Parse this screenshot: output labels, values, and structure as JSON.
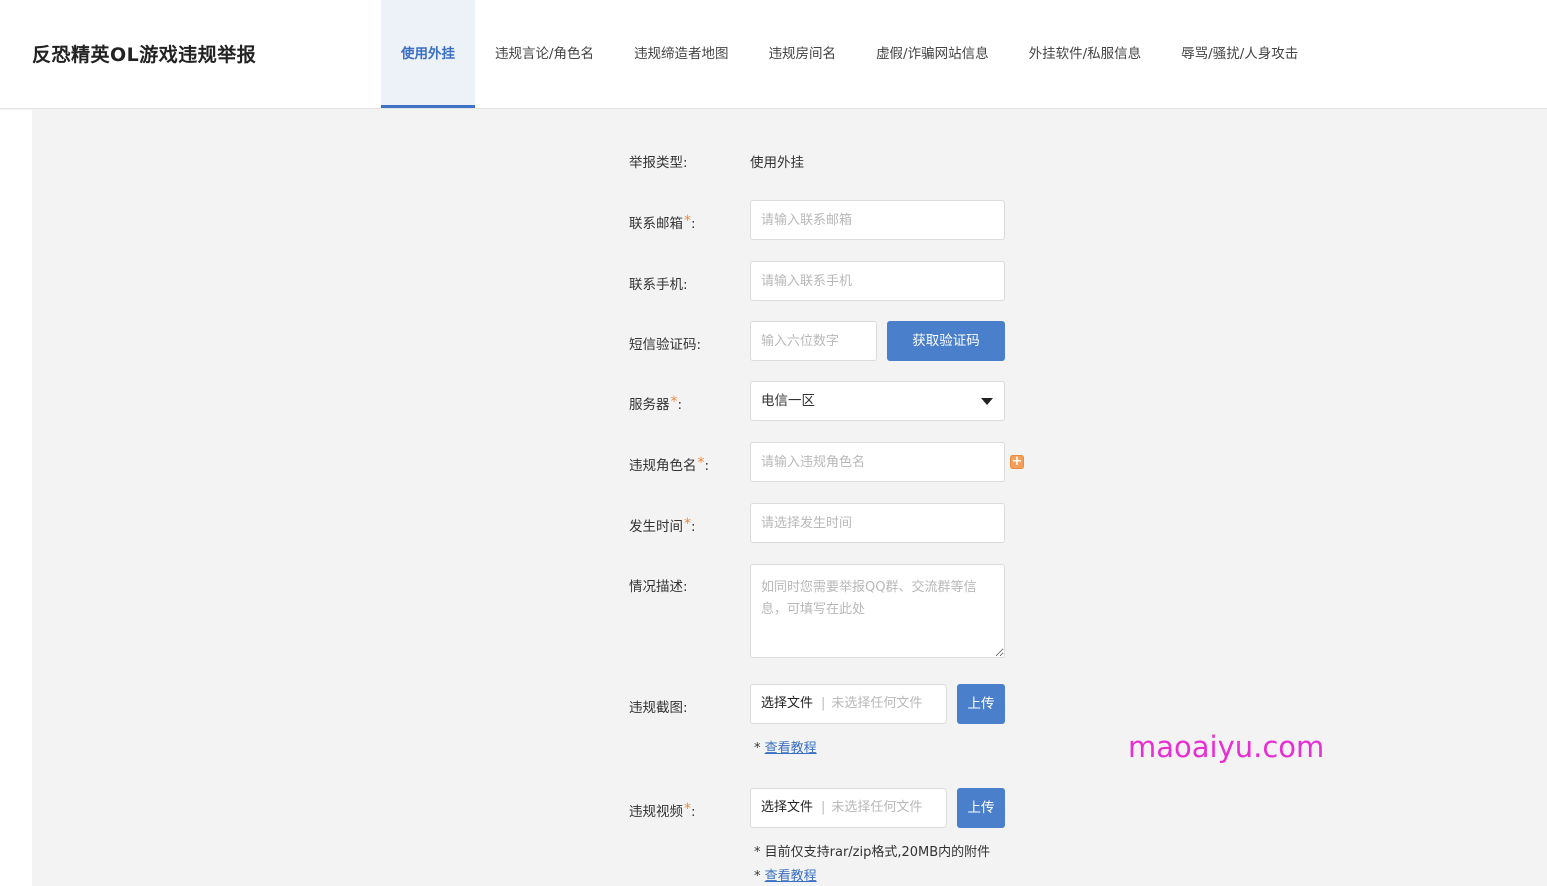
{
  "header": {
    "title": "反恐精英OL游戏违规举报",
    "tabs": [
      {
        "label": "使用外挂",
        "active": true
      },
      {
        "label": "违规言论/角色名"
      },
      {
        "label": "违规缔造者地图"
      },
      {
        "label": "违规房间名"
      },
      {
        "label": "虚假/诈骗网站信息"
      },
      {
        "label": "外挂软件/私服信息"
      },
      {
        "label": "辱骂/骚扰/人身攻击"
      }
    ]
  },
  "form": {
    "report_type": {
      "label": "举报类型:",
      "value": "使用外挂"
    },
    "email": {
      "label": "联系邮箱",
      "colon": ":",
      "placeholder": "请输入联系邮箱",
      "required": true
    },
    "phone": {
      "label": "联系手机:",
      "placeholder": "请输入联系手机"
    },
    "sms_code": {
      "label": "短信验证码:",
      "placeholder": "输入六位数字",
      "button": "获取验证码"
    },
    "server": {
      "label": "服务器",
      "colon": ":",
      "value": "电信一区",
      "required": true
    },
    "role_name": {
      "label": "违规角色名",
      "colon": ":",
      "placeholder": "请输入违规角色名",
      "required": true,
      "add_icon": "plus-icon"
    },
    "time": {
      "label": "发生时间",
      "colon": ":",
      "placeholder": "请选择发生时间",
      "required": true
    },
    "description": {
      "label": "情况描述:",
      "placeholder": "如同时您需要举报QQ群、交流群等信息，可填写在此处"
    },
    "screenshot": {
      "label": "违规截图:",
      "file_button": "选择文件",
      "file_status": "未选择任何文件",
      "upload": "上传",
      "note_prefix": "* ",
      "tutorial": "查看教程"
    },
    "video": {
      "label": "违规视频",
      "colon": ":",
      "required": true,
      "file_button": "选择文件",
      "file_status": "未选择任何文件",
      "upload": "上传",
      "note1": "* 目前仅支持rar/zip格式,20MB内的附件",
      "note_prefix": "* ",
      "tutorial": "查看教程"
    },
    "required_mark": "*"
  },
  "watermark": "maoaiyu.com",
  "colors": {
    "accent": "#4a7fcb",
    "required": "#f08a3c",
    "watermark": "#e830d2"
  }
}
